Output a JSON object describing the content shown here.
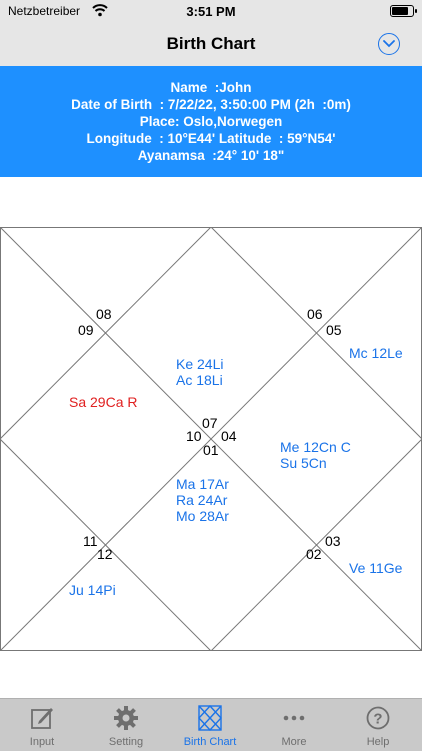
{
  "status_bar": {
    "carrier": "Netzbetreiber",
    "time": "3:51 PM",
    "battery_level": 0.9
  },
  "nav": {
    "title": "Birth Chart"
  },
  "info": {
    "name": "Name  :John",
    "date_of_birth": "Date of Birth  : 7/22/22, 3:50:00 PM (2h  :0m)",
    "place": "Place: Oslo,Norwegen",
    "coordinates": "Longitude  : 10°E44' Latitude  : 59°N54'",
    "ayanamsa": "Ayanamsa  :24° 10' 18\""
  },
  "chart": {
    "house_numbers": {
      "h09": "09",
      "h08": "08",
      "h06": "06",
      "h05": "05",
      "h07": "07",
      "h10": "10",
      "h04": "04",
      "h01": "01",
      "h11": "11",
      "h12": "12",
      "h03": "03",
      "h02": "02"
    },
    "planets": {
      "mc": "Mc 12Le",
      "ke": "Ke 24Li",
      "ac": "Ac 18Li",
      "sa": "Sa 29Ca R",
      "me": "Me 12Cn C",
      "su": "Su 5Cn",
      "ma": "Ma 17Ar",
      "ra": "Ra 24Ar",
      "mo": "Mo 28Ar",
      "ju": "Ju 14Pi",
      "ve": "Ve 11Ge"
    },
    "colors": {
      "planet": "#1a73e8",
      "retrograde": "#e02020"
    }
  },
  "tabs": [
    {
      "label": "Input",
      "icon": "edit-icon",
      "active": false
    },
    {
      "label": "Setting",
      "icon": "gear-icon",
      "active": false
    },
    {
      "label": "Birth Chart",
      "icon": "chart-grid-icon",
      "active": true
    },
    {
      "label": "More",
      "icon": "more-icon",
      "active": false
    },
    {
      "label": "Help",
      "icon": "help-icon",
      "active": false
    }
  ],
  "colors": {
    "accent": "#1a73e8",
    "panel": "#1e90ff",
    "bars": "#e6e6e6",
    "tabbar": "#c9c9c9"
  }
}
